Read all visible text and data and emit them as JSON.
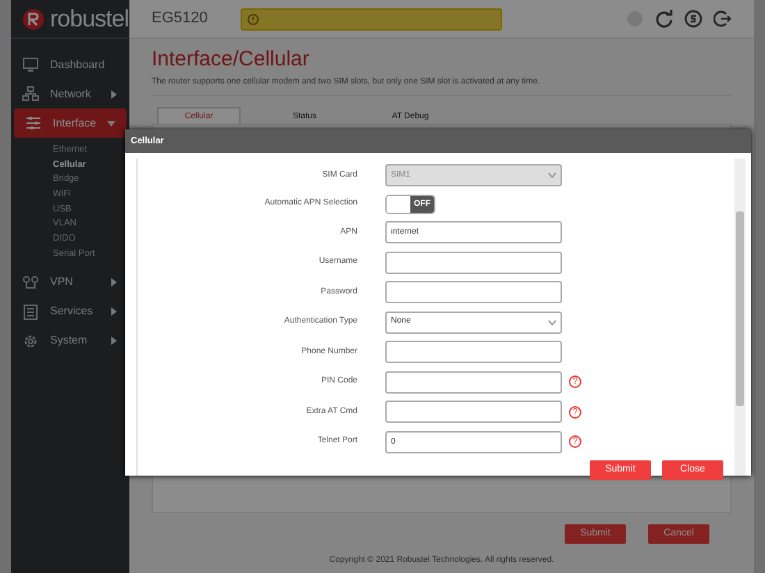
{
  "header": {
    "logo": "robustel",
    "device": "EG5120"
  },
  "sidebar": {
    "items": [
      {
        "label": "Dashboard",
        "kind": "leaf",
        "selected": false
      },
      {
        "label": "Network",
        "kind": "group",
        "selected": false,
        "expanded": false
      },
      {
        "label": "Interface",
        "kind": "group",
        "selected": true,
        "expanded": true,
        "children": [
          {
            "label": "Ethernet",
            "selected": false
          },
          {
            "label": "Cellular",
            "selected": true
          },
          {
            "label": "Bridge",
            "selected": false
          },
          {
            "label": "WiFi",
            "selected": false
          },
          {
            "label": "USB",
            "selected": false
          },
          {
            "label": "VLAN",
            "selected": false
          },
          {
            "label": "DIDO",
            "selected": false
          },
          {
            "label": "Serial Port",
            "selected": false
          }
        ]
      },
      {
        "label": "VPN",
        "kind": "group",
        "selected": false,
        "expanded": false
      },
      {
        "label": "Services",
        "kind": "group",
        "selected": false,
        "expanded": false
      },
      {
        "label": "System",
        "kind": "group",
        "selected": false,
        "expanded": false
      }
    ]
  },
  "page": {
    "title": "Interface/Cellular",
    "description": "The router supports one cellular modem and two SIM slots, but only one SIM slot is activated at any time.",
    "tabs": [
      {
        "label": "Cellular",
        "selected": true
      },
      {
        "label": "Status",
        "selected": false
      },
      {
        "label": "AT Debug",
        "selected": false
      }
    ],
    "buttons": [
      "Submit",
      "Cancel"
    ]
  },
  "footer": "Copyright © 2021 Robustel Technologies. All rights reserved.",
  "dialog": {
    "title": "Cellular",
    "fields": [
      {
        "label": "SIM Card",
        "kind": "select",
        "value": "SIM1",
        "disabled": true
      },
      {
        "label": "Automatic APN Selection",
        "kind": "toggle",
        "on": false,
        "state_label": "OFF"
      },
      {
        "label": "APN",
        "kind": "text",
        "value": "internet"
      },
      {
        "label": "Username",
        "kind": "text"
      },
      {
        "label": "Password",
        "kind": "text"
      },
      {
        "label": "Authentication Type",
        "kind": "select",
        "value": "None",
        "disabled": false
      },
      {
        "label": "Phone Number",
        "kind": "text"
      },
      {
        "label": "PIN Code",
        "kind": "text",
        "help_icon": "?"
      },
      {
        "label": "Extra AT Cmd",
        "kind": "text",
        "help_icon": "?"
      },
      {
        "label": "Telnet Port",
        "kind": "text",
        "value": "0",
        "help_icon": "?"
      }
    ],
    "buttons": [
      "Submit",
      "Close"
    ]
  }
}
